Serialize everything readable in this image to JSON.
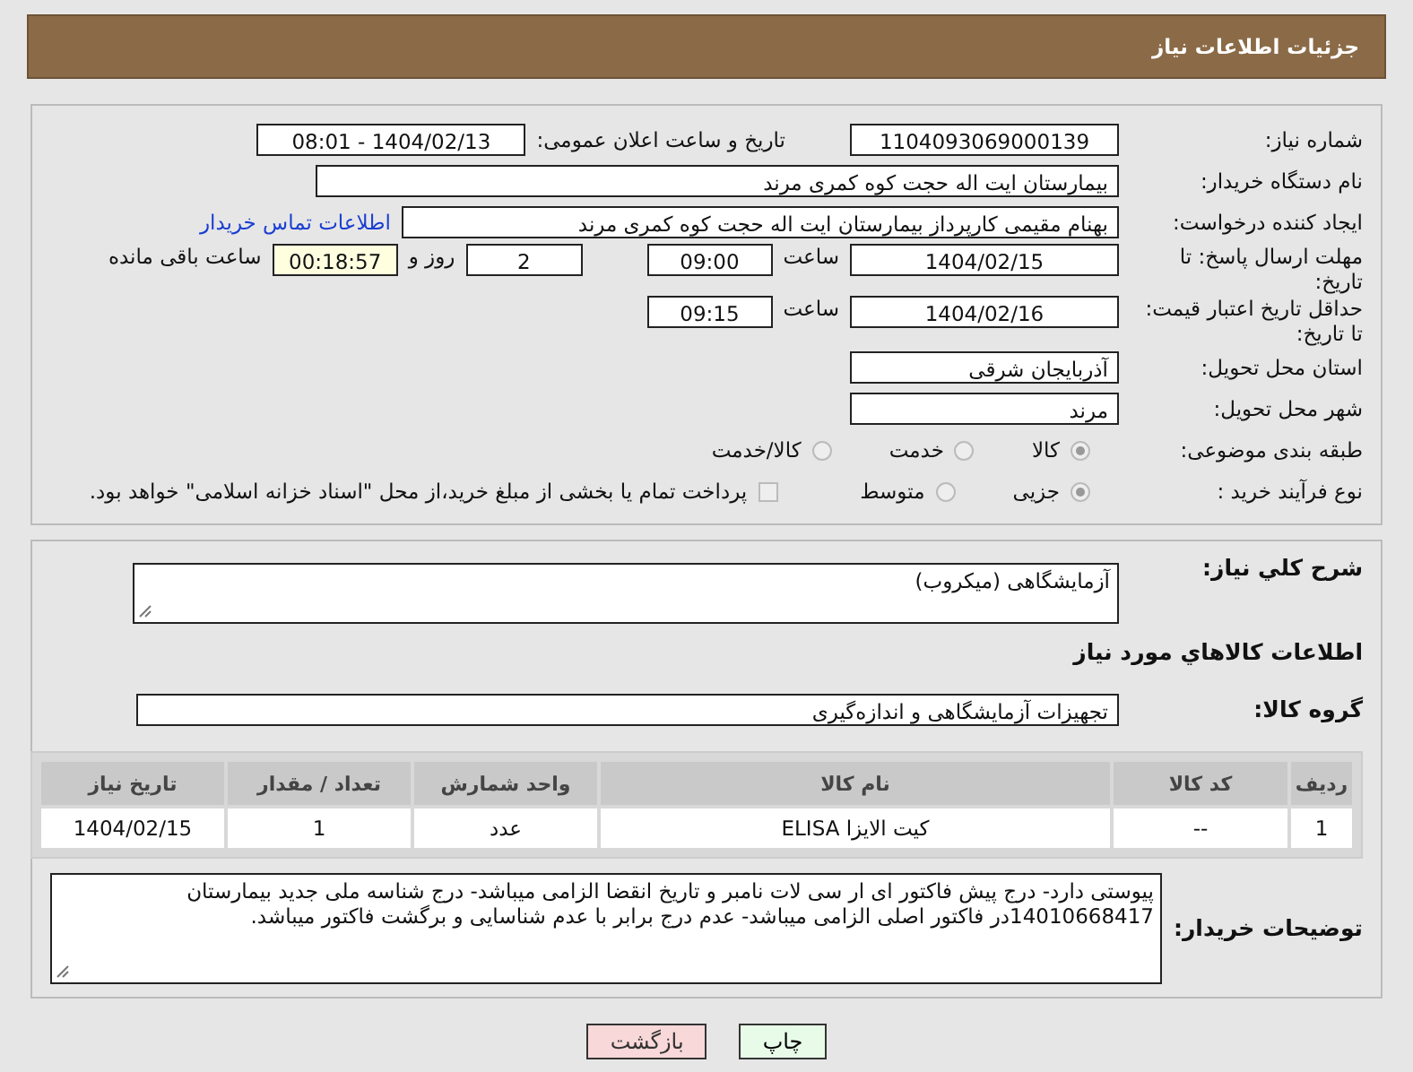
{
  "header": {
    "title": "جزئیات اطلاعات نیاز"
  },
  "need_number": {
    "label": "شماره نیاز:",
    "value": "1104093069000139"
  },
  "announce": {
    "label": "تاریخ و ساعت اعلان عمومی:",
    "value": "1404/02/13 - 08:01"
  },
  "buyer_org": {
    "label": "نام دستگاه خریدار:",
    "value": "بیمارستان ایت اله حجت کوه کمری مرند"
  },
  "requester": {
    "label": "ایجاد کننده درخواست:",
    "value": "بهنام مقیمی کارپرداز بیمارستان ایت اله حجت کوه کمری مرند",
    "link": "اطلاعات تماس خریدار"
  },
  "deadline": {
    "label": "مهلت ارسال پاسخ: تا تاریخ:",
    "date": "1404/02/15",
    "time_label": "ساعت",
    "time": "09:00",
    "days": "2",
    "days_label": "روز و",
    "remaining": "00:18:57",
    "remaining_label": "ساعت باقی مانده"
  },
  "price_validity": {
    "label": "حداقل تاریخ اعتبار قیمت: تا تاریخ:",
    "date": "1404/02/16",
    "time_label": "ساعت",
    "time": "09:15"
  },
  "province": {
    "label": "استان محل تحویل:",
    "value": "آذربایجان شرقی"
  },
  "city": {
    "label": "شهر محل تحویل:",
    "value": "مرند"
  },
  "category": {
    "label": "طبقه بندی موضوعی:",
    "options": [
      {
        "label": "کالا",
        "selected": true
      },
      {
        "label": "خدمت",
        "selected": false
      },
      {
        "label": "کالا/خدمت",
        "selected": false
      }
    ]
  },
  "purchase_type": {
    "label": "نوع فرآیند خرید :",
    "options": [
      {
        "label": "جزیی",
        "selected": true
      },
      {
        "label": "متوسط",
        "selected": false
      }
    ],
    "treasury": {
      "checked": false,
      "label": "پرداخت تمام یا بخشی از مبلغ خرید،از محل \"اسناد خزانه اسلامی\" خواهد بود."
    }
  },
  "description": {
    "label": "شرح کلي نياز:",
    "value": "آزمایشگاهی (میکروب)"
  },
  "goods_heading": "اطلاعات کالاهاي مورد نياز",
  "goods_group": {
    "label": "گروه کالا:",
    "value": "تجهیزات آزمایشگاهی و اندازه‌گیری"
  },
  "table": {
    "columns": [
      "ردیف",
      "کد کالا",
      "نام کالا",
      "واحد شمارش",
      "تعداد / مقدار",
      "تاریخ نیاز"
    ],
    "rows": [
      [
        "1",
        "--",
        "کیت الایزا ELISA",
        "عدد",
        "1",
        "1404/02/15"
      ]
    ]
  },
  "buyer_notes": {
    "label": "توضیحات خریدار:",
    "value": "پیوستی دارد- درج پیش فاکتور ای ار سی لات نامبر و تاریخ انقضا الزامی میباشد- درج شناسه ملی  جدید بیمارستان 14010668417در فاکتور اصلی الزامی میباشد- عدم درج برابر با عدم شناسایی و برگشت فاکتور میباشد."
  },
  "buttons": [
    {
      "kind": "print",
      "label": "چاپ"
    },
    {
      "kind": "back",
      "label": "بازگشت"
    }
  ]
}
